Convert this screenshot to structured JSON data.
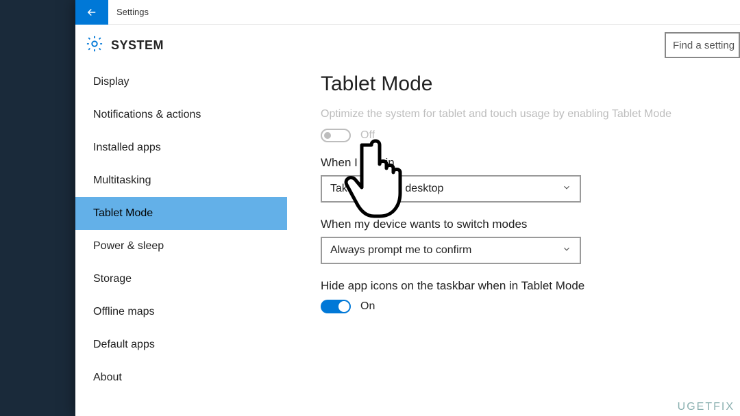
{
  "title_bar": {
    "title": "Settings"
  },
  "header": {
    "system_label": "SYSTEM",
    "search_placeholder": "Find a setting"
  },
  "sidebar": {
    "items": [
      {
        "label": "Display"
      },
      {
        "label": "Notifications & actions"
      },
      {
        "label": "Installed apps"
      },
      {
        "label": "Multitasking"
      },
      {
        "label": "Tablet Mode"
      },
      {
        "label": "Power & sleep"
      },
      {
        "label": "Storage"
      },
      {
        "label": "Offline maps"
      },
      {
        "label": "Default apps"
      },
      {
        "label": "About"
      }
    ],
    "selected_index": 4
  },
  "content": {
    "heading": "Tablet Mode",
    "optimize_desc": "Optimize the system for tablet and touch usage by enabling Tablet Mode",
    "optimize_toggle": {
      "state": "Off",
      "enabled": false
    },
    "signin_label": "When I sign in",
    "signin_value": "Take me to the desktop",
    "switch_label": "When my device wants to switch modes",
    "switch_value": "Always prompt me to confirm",
    "hide_icons_label": "Hide app icons on the taskbar when in Tablet Mode",
    "hide_icons_toggle": {
      "state": "On",
      "enabled": true
    }
  },
  "watermark": "UGETFIX"
}
